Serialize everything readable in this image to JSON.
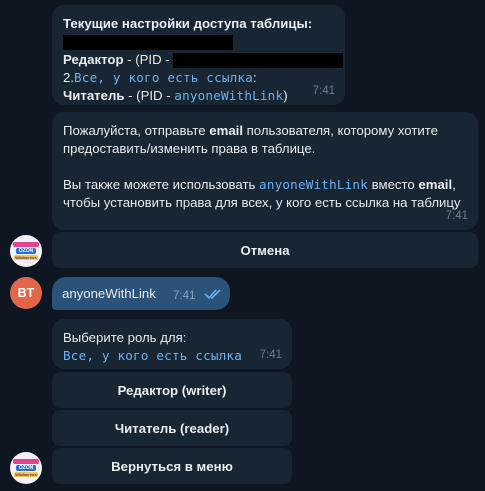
{
  "msg1": {
    "title": "Текущие настройки доступа таблицы:",
    "editor_role": "Редактор",
    "editor_pid_prefix": " - (PID - ",
    "item2_number": "2.",
    "item2_link": "Все, у кого есть ссылка",
    "item2_suffix": ":",
    "reader_role": "Читатель",
    "reader_pid_prefix": " - (PID - ",
    "reader_pid": "anyoneWithLink",
    "reader_pid_suffix": ")",
    "time": "7:41"
  },
  "msg2": {
    "p1_before": "Пожалуйста, отправьте ",
    "p1_bold": "email",
    "p1_after": " пользователя, которому хотите",
    "p1_line2": "предоставить/изменить права в таблице.",
    "p2_before": "Вы также можете использовать ",
    "p2_code": "anyoneWithLink",
    "p2_mid": " вместо ",
    "p2_bold": "email",
    "p2_after": ",",
    "p2_line2": "чтобы установить права для всех, у кого есть ссылка на таблицу",
    "time": "7:41"
  },
  "kb1": {
    "cancel": "Отмена"
  },
  "user_msg": {
    "avatar_initials": "BT",
    "text": "anyoneWithLink",
    "time": "7:41",
    "status_icon": "double-check-icon"
  },
  "msg3": {
    "line1": "Выберите роль для:",
    "line2": "Все, у кого есть ссылка",
    "time": "7:41"
  },
  "kb2": {
    "writer": "Редактор (writer)",
    "reader": "Читатель (reader)",
    "back": "Вернуться в меню"
  },
  "bot_avatar": {
    "logo_text": "OZON",
    "logo_sub": "Wildberries"
  },
  "colors": {
    "background": "#0e1621",
    "bubble_in": "#182533",
    "bubble_out": "#2b5278",
    "link": "#6ab3f3",
    "avatar_user": "#e2674a"
  }
}
